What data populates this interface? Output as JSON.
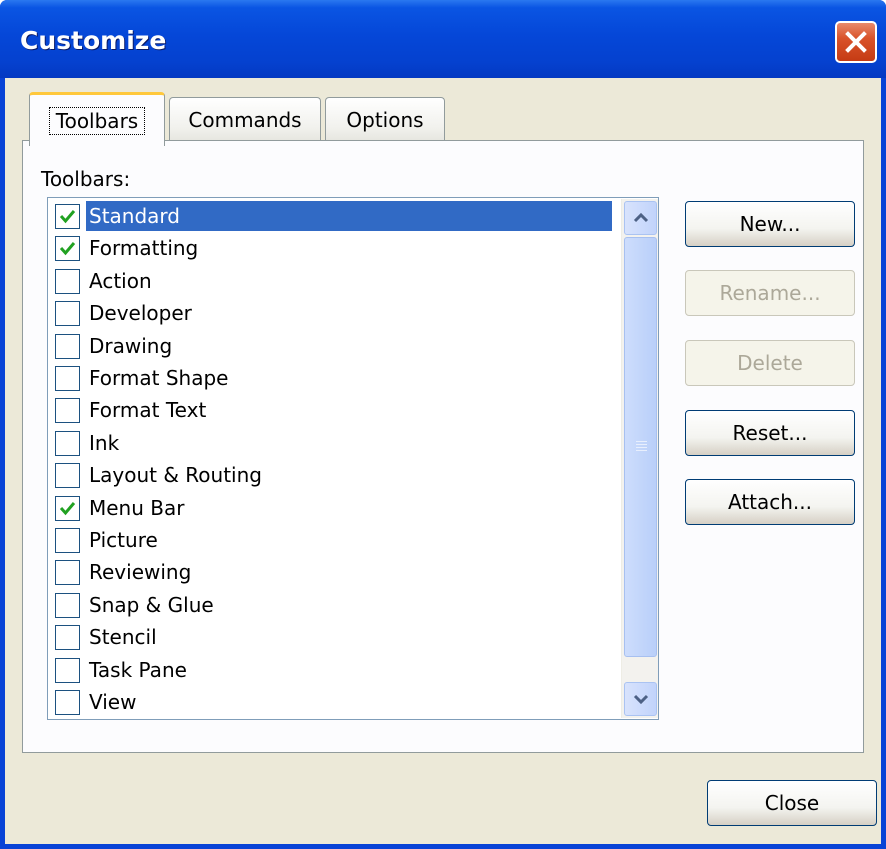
{
  "window": {
    "title": "Customize"
  },
  "tabs": [
    {
      "label": "Toolbars",
      "active": true
    },
    {
      "label": "Commands",
      "active": false
    },
    {
      "label": "Options",
      "active": false
    }
  ],
  "toolbars_label": "Toolbars:",
  "toolbars": [
    {
      "label": "Standard",
      "checked": true,
      "selected": true
    },
    {
      "label": "Formatting",
      "checked": true,
      "selected": false
    },
    {
      "label": "Action",
      "checked": false,
      "selected": false
    },
    {
      "label": "Developer",
      "checked": false,
      "selected": false
    },
    {
      "label": "Drawing",
      "checked": false,
      "selected": false
    },
    {
      "label": "Format Shape",
      "checked": false,
      "selected": false
    },
    {
      "label": "Format Text",
      "checked": false,
      "selected": false
    },
    {
      "label": "Ink",
      "checked": false,
      "selected": false
    },
    {
      "label": "Layout & Routing",
      "checked": false,
      "selected": false
    },
    {
      "label": "Menu Bar",
      "checked": true,
      "selected": false
    },
    {
      "label": "Picture",
      "checked": false,
      "selected": false
    },
    {
      "label": "Reviewing",
      "checked": false,
      "selected": false
    },
    {
      "label": "Snap & Glue",
      "checked": false,
      "selected": false
    },
    {
      "label": "Stencil",
      "checked": false,
      "selected": false
    },
    {
      "label": "Task Pane",
      "checked": false,
      "selected": false
    },
    {
      "label": "View",
      "checked": false,
      "selected": false
    }
  ],
  "buttons": {
    "new": "New...",
    "rename": "Rename...",
    "delete": "Delete",
    "reset": "Reset...",
    "attach": "Attach...",
    "close": "Close"
  },
  "colors": {
    "titlebar": "#0a55e3",
    "selection": "#316ac5",
    "face": "#ece9d8",
    "close": "#d9532a",
    "check": "#21a121"
  }
}
